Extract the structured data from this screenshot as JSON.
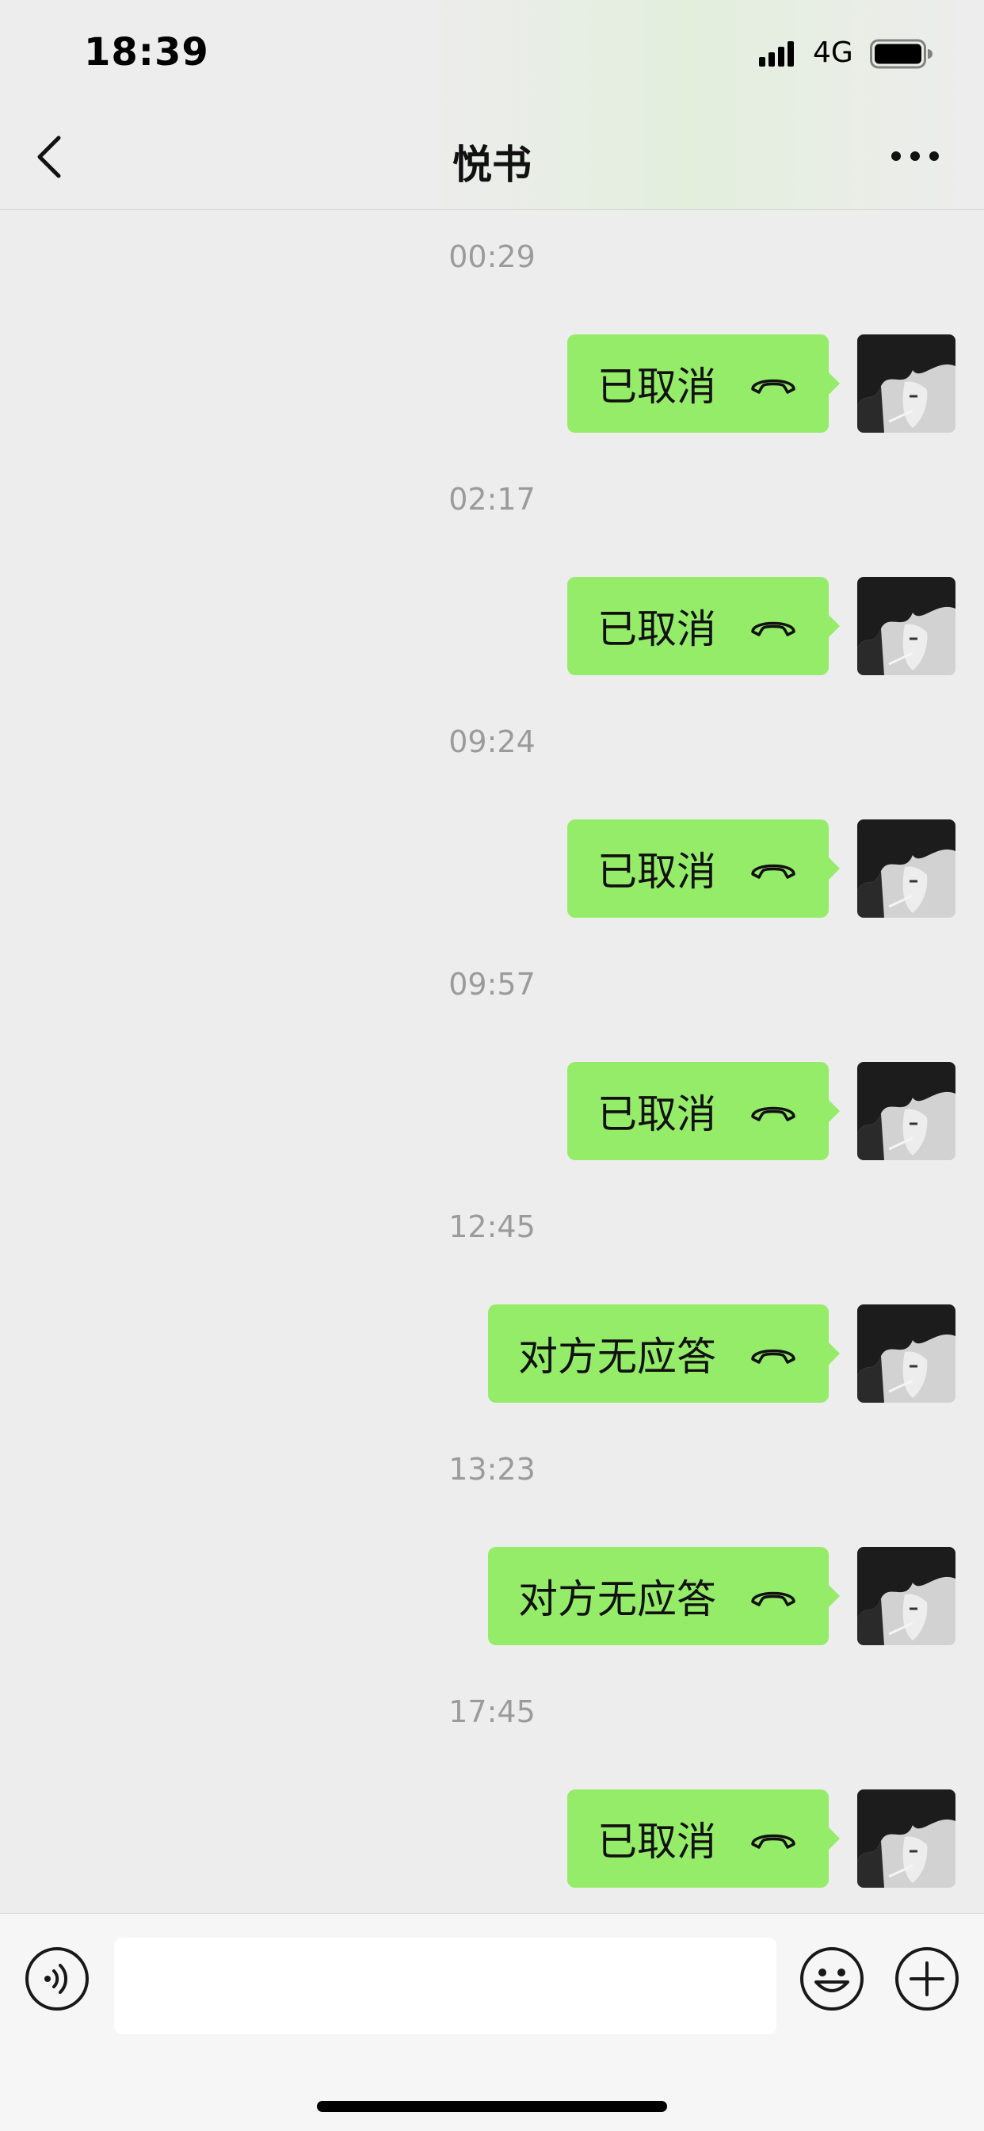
{
  "status_bar": {
    "time": "18:39",
    "network": "4G",
    "icons": [
      "signal-icon",
      "battery-icon"
    ]
  },
  "nav": {
    "title": "悦书",
    "icons": [
      "back-chevron-icon",
      "more-icon"
    ]
  },
  "messages": [
    {
      "time": "00:29",
      "text": "已取消",
      "icon": "phone-hangup-icon"
    },
    {
      "time": "02:17",
      "text": "已取消",
      "icon": "phone-hangup-icon"
    },
    {
      "time": "09:24",
      "text": "已取消",
      "icon": "phone-hangup-icon"
    },
    {
      "time": "09:57",
      "text": "已取消",
      "icon": "phone-hangup-icon"
    },
    {
      "time": "12:45",
      "text": "对方无应答",
      "icon": "phone-hangup-icon"
    },
    {
      "time": "13:23",
      "text": "对方无应答",
      "icon": "phone-hangup-icon"
    },
    {
      "time": "17:45",
      "text": "已取消",
      "icon": "phone-hangup-icon"
    }
  ],
  "input_bar": {
    "text_value": "",
    "icons": [
      "voice-icon",
      "emoji-icon",
      "plus-icon"
    ]
  },
  "colors": {
    "bubble": "#95ec69",
    "background": "#ededed",
    "timestamp": "#9b9b9b"
  }
}
